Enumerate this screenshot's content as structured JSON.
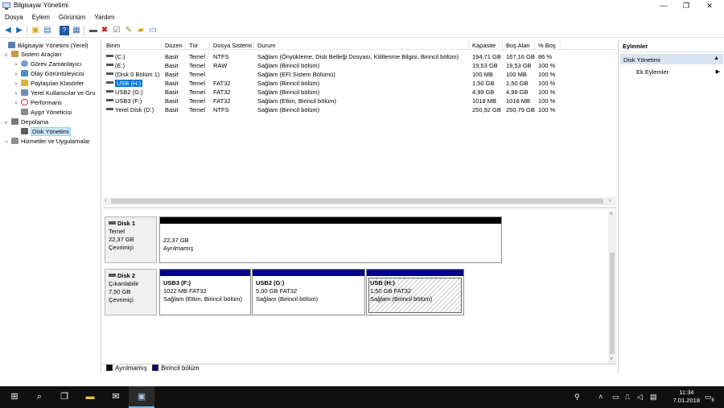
{
  "window": {
    "title": "Bilgisayar Yönetimi"
  },
  "menu": [
    "Dosya",
    "Eylem",
    "Görünüm",
    "Yardım"
  ],
  "tree": [
    {
      "label": "Bilgisayar Yönetimi (Yerel)",
      "icon": "computer-icon",
      "expander": ""
    },
    {
      "label": "Sistem Araçları",
      "icon": "tools-icon",
      "expander": "v"
    },
    {
      "label": "Görev Zamanlayıcı",
      "icon": "clock-icon",
      "expander": ">"
    },
    {
      "label": "Olay Görüntüleyicisi",
      "icon": "event-viewer-icon",
      "expander": ">"
    },
    {
      "label": "Paylaşılan Klasörler",
      "icon": "shared-folder-icon",
      "expander": ">"
    },
    {
      "label": "Yerel Kullanıcılar ve Gru",
      "icon": "users-icon",
      "expander": ">"
    },
    {
      "label": "Performans",
      "icon": "performance-icon",
      "expander": ">"
    },
    {
      "label": "Aygıt Yöneticisi",
      "icon": "device-manager-icon",
      "expander": ""
    },
    {
      "label": "Depolama",
      "icon": "storage-icon",
      "expander": "v"
    },
    {
      "label": "Disk Yönetimi",
      "icon": "disk-management-icon",
      "expander": ""
    },
    {
      "label": "Hizmetler ve Uygulamalar",
      "icon": "services-icon",
      "expander": ">"
    }
  ],
  "volumes": {
    "headers": [
      "Birim",
      "Düzen",
      "Tür",
      "Dosya Sistemi",
      "Durum",
      "Kapasite",
      "Boş Alan",
      "% Boş"
    ],
    "rows": [
      [
        "(C:)",
        "Basit",
        "Temel",
        "NTFS",
        "Sağlam (Önyükleme, Disk Belleği Dosyası, Kilitlenme Bilgisi, Birincil bölüm)",
        "194,71 GB",
        "167,16 GB",
        "86 %"
      ],
      [
        "(E:)",
        "Basit",
        "Temel",
        "RAW",
        "Sağlam (Birincil bölüm)",
        "19,53 GB",
        "19,53 GB",
        "100 %"
      ],
      [
        "(Disk 0 Bölüm 1)",
        "Basit",
        "Temel",
        "",
        "Sağlam (EFI Sistem Bölümü)",
        "100 MB",
        "100 MB",
        "100 %"
      ],
      [
        "USB (H:)",
        "Basit",
        "Temel",
        "FAT32",
        "Sağlam (Birincil bölüm)",
        "1,50 GB",
        "1,50 GB",
        "100 %"
      ],
      [
        "USB2 (G:)",
        "Basit",
        "Temel",
        "FAT32",
        "Sağlam (Birincil bölüm)",
        "4,99 GB",
        "4,99 GB",
        "100 %"
      ],
      [
        "USB3 (F:)",
        "Basit",
        "Temel",
        "FAT32",
        "Sağlam (Etkin, Birincil bölüm)",
        "1018 MB",
        "1018 MB",
        "100 %"
      ],
      [
        "Yerel Disk (D:)",
        "Basit",
        "Temel",
        "NTFS",
        "Sağlam (Birincil bölüm)",
        "250,92 GB",
        "250,79 GB",
        "100 %"
      ]
    ]
  },
  "disks": [
    {
      "name": "Disk 1",
      "type": "Temel",
      "size": "22,37 GB",
      "status": "Çevrimiçi",
      "partitions": [
        {
          "title": "",
          "line1": "22,37 GB",
          "line2": "Ayrılmamış",
          "kind": "unallocated"
        }
      ]
    },
    {
      "name": "Disk 2",
      "type": "Çıkarılabilir",
      "size": "7,50 GB",
      "status": "Çevrimiçi",
      "partitions": [
        {
          "title": "USB3  (F:)",
          "line1": "1022 MB FAT32",
          "line2": "Sağlam (Etkin, Birincil bölüm)",
          "kind": "primary"
        },
        {
          "title": "USB2  (G:)",
          "line1": "5,00 GB FAT32",
          "line2": "Sağlam (Birincil bölüm)",
          "kind": "primary"
        },
        {
          "title": "USB  (H:)",
          "line1": "1,50 GB FAT32",
          "line2": "Sağlam (Birincil bölüm)",
          "kind": "primary-selected"
        }
      ]
    }
  ],
  "legend": [
    {
      "label": "Ayrılmamış",
      "color": "#000000"
    },
    {
      "label": "Birincil bölüm",
      "color": "#00008b"
    }
  ],
  "actions": {
    "title": "Eylemler",
    "section": "Disk Yönetimi",
    "item": "Ek Eylemler"
  },
  "taskbar": {
    "time": "11:34",
    "date": "7.01.2018",
    "notification_count": "6"
  },
  "colors": {
    "primary_partition": "#00008b",
    "unallocated": "#000000",
    "selection": "#0078d7"
  }
}
